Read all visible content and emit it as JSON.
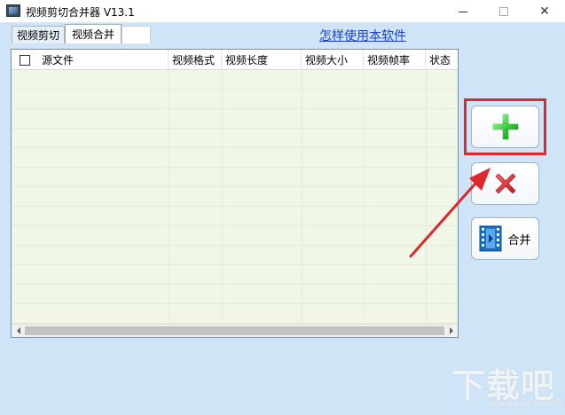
{
  "window": {
    "title": "视频剪切合并器 V13.1",
    "minimize_icon": "minimize-icon",
    "maximize_icon": "maximize-icon",
    "close_glyph": "✕"
  },
  "tabs": [
    {
      "label": "视频剪切",
      "active": false
    },
    {
      "label": "视频合并",
      "active": true
    }
  ],
  "help_link": "怎样使用本软件",
  "file_list": {
    "columns": [
      "源文件",
      "视频格式",
      "视频长度",
      "视频大小",
      "视频帧率",
      "状态"
    ],
    "rows": [],
    "select_all_checked": false
  },
  "buttons": {
    "add_icon": "plus-icon",
    "delete_icon": "cross-icon",
    "merge_icon": "film-icon",
    "merge_label": "合并"
  },
  "annotation": {
    "highlight_color": "#e0272b",
    "target": "add-button"
  },
  "watermark": {
    "text": "下载吧",
    "url": "www.xiazaiba.com"
  },
  "colors": {
    "background": "#cfe4f7",
    "list_background": "#f1f7e6",
    "link": "#1a3fcf",
    "plus_green": "#10a81a",
    "cross_red": "#e02020"
  }
}
